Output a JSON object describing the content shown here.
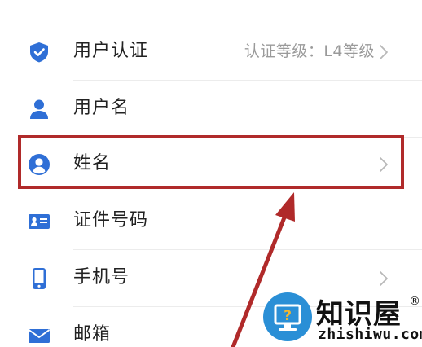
{
  "settings": {
    "items": [
      {
        "label": "用户认证",
        "value": "认证等级：L4等级",
        "icon": "shield-check-icon",
        "has_chevron": true
      },
      {
        "label": "用户名",
        "value": "",
        "icon": "person-icon",
        "has_chevron": false
      },
      {
        "label": "姓名",
        "value": "",
        "icon": "user-circle-icon",
        "has_chevron": true
      },
      {
        "label": "证件号码",
        "value": "",
        "icon": "id-card-icon",
        "has_chevron": false
      },
      {
        "label": "手机号",
        "value": "",
        "icon": "mobile-phone-icon",
        "has_chevron": true
      },
      {
        "label": "邮箱",
        "value": "",
        "icon": "envelope-icon",
        "has_chevron": false
      }
    ]
  },
  "annotation": {
    "highlight_color": "#b02a2a",
    "arrow_color": "#b02a2a"
  },
  "watermark": {
    "brand": "知识屋",
    "registered_mark": "®",
    "url": "zhishiwu.com",
    "logo_glyph": "?",
    "logo_color": "#2a8fd6"
  },
  "colors": {
    "icon_blue": "#2f6fd6",
    "label_text": "#222222",
    "value_text": "#9a9a9a",
    "divider": "#ececec"
  }
}
